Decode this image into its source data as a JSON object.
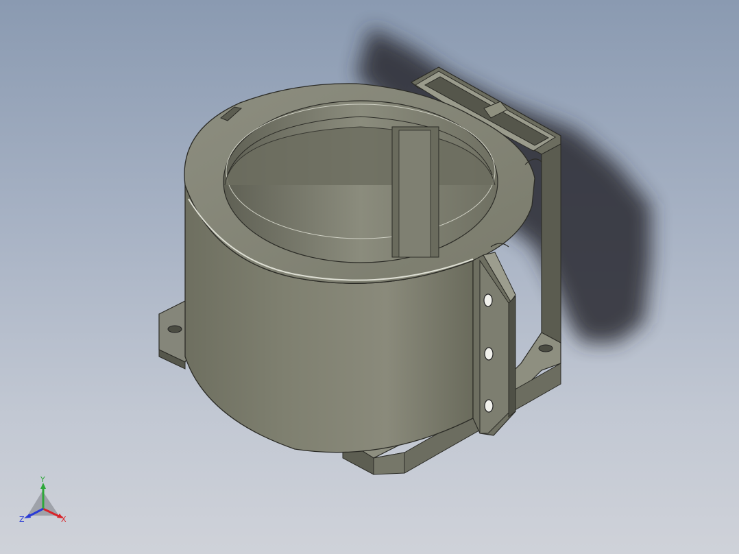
{
  "viewport": {
    "background_top": "#8a9ab1",
    "background_bottom": "#cfd2d9"
  },
  "model": {
    "body_color": "#7b7c6c",
    "shadow_color": "#2a2c31"
  },
  "triad": {
    "x_label": "X",
    "y_label": "Y",
    "z_label": "Z",
    "x_color": "#d8242a",
    "y_color": "#2ea83a",
    "z_color": "#2a3bd6"
  }
}
